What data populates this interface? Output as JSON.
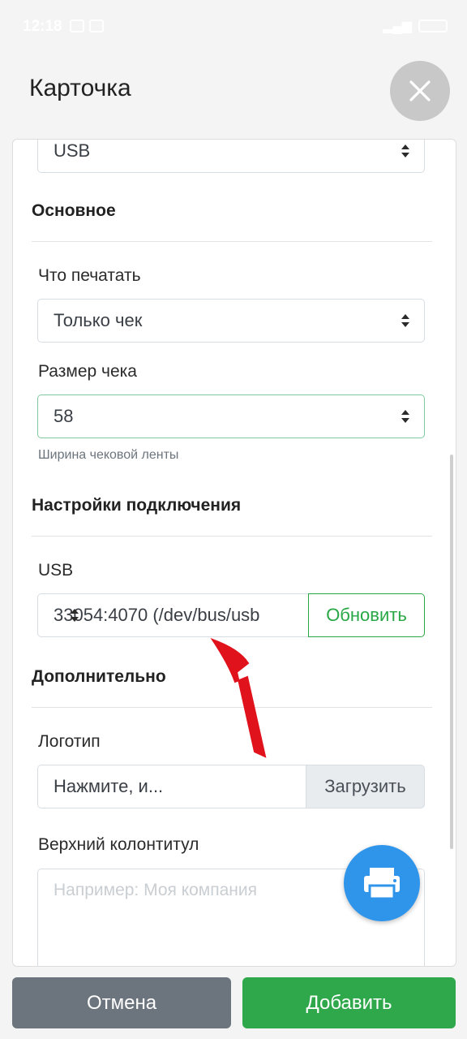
{
  "status_bar": {
    "time": "12:18"
  },
  "header": {
    "title": "Карточка",
    "close_icon": "close-icon"
  },
  "form": {
    "connection_type_value": "USB",
    "sections": {
      "basic": "Основное",
      "connection": "Настройки подключения",
      "additional": "Дополнительно"
    },
    "print_what": {
      "label": "Что печатать",
      "value": "Только чек"
    },
    "receipt_size": {
      "label": "Размер чека",
      "value": "58",
      "hint": "Ширина чековой ленты"
    },
    "usb": {
      "label": "USB",
      "value": "33054:4070 (/dev/bus/usb",
      "refresh_label": "Обновить"
    },
    "logo": {
      "label": "Логотип",
      "value": "Нажмите, и...",
      "upload_label": "Загрузить"
    },
    "header_text": {
      "label": "Верхний колонтитул",
      "placeholder": "Например: Моя компания"
    }
  },
  "fab": {
    "icon": "printer-icon",
    "color": "#2f95ea"
  },
  "footer": {
    "cancel_label": "Отмена",
    "add_label": "Добавить"
  },
  "colors": {
    "primary": "#2ea84a",
    "secondary": "#6c757d",
    "annotation_arrow": "#e0131d"
  }
}
